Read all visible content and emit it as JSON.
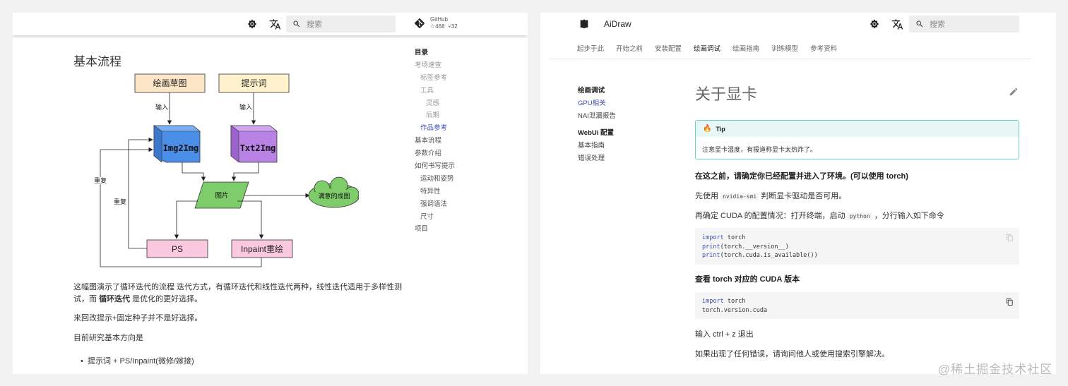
{
  "left": {
    "search_placeholder": "搜索",
    "github": {
      "label": "GitHub",
      "stars": "468",
      "forks": "32"
    },
    "title": "基本流程",
    "diagram": {
      "sketch": "绘画草图",
      "prompt": "提示词",
      "input1": "输入",
      "input2": "输入",
      "img2img": "Img2Img",
      "txt2img": "Txt2Img",
      "picture": "图片",
      "result": "满意的成图",
      "repeat1": "重复",
      "repeat2": "重复",
      "ps": "PS",
      "inpaint": "Inpaint重绘"
    },
    "para1_a": "这幅图演示了循环迭代的流程 迭代方式，有循环迭代和线性迭代两种，线性迭代适用于多样性测",
    "para1_b1": "试，而 ",
    "para1_b_bold": "循环迭代",
    "para1_b2": " 是优化的更好选择。",
    "para2": "来回改提示+固定种子并不是好选择。",
    "para3": "目前研究基本方向是",
    "bullet1": "提示词 + PS/Inpaint(微修/嫁接)",
    "toc": {
      "heading": "目录",
      "items": [
        "考场速查",
        "标签参考",
        "工具",
        "灵感",
        "后期",
        "作品参考",
        "基本流程",
        "参数介绍",
        "如何书写提示",
        "运动和姿势",
        "特异性",
        "强调语法",
        "尺寸",
        "项目"
      ]
    }
  },
  "right": {
    "site_title": "AiDraw",
    "search_placeholder": "搜索",
    "tabs": [
      "起步于此",
      "开始之前",
      "安装配置",
      "绘画调试",
      "绘画指南",
      "训练模型",
      "参考资料"
    ],
    "nav": [
      "绘画调试",
      "GPU相关",
      "NAI泄漏报告",
      "WebUi 配置",
      "基本指南",
      "错误处理"
    ],
    "title": "关于显卡",
    "tip_label": "Tip",
    "tip_text": "注意显卡温度，有报道称显卡太热炸了。",
    "p1": "在这之前，请确定你已经配置并进入了环境。(可以使用 torch)",
    "p2_a": "先使用 ",
    "p2_code": "nvidia-smi",
    "p2_b": " 判断显卡驱动是否可用。",
    "p3_a": "再确定 CUDA 的配置情况：打开终端，启动 ",
    "p3_code": "python",
    "p3_b": " ，分行输入如下命令",
    "code1": {
      "l1_kw": "import",
      "l1_rest": " torch",
      "l2_kw": "print",
      "l2_rest": "(torch.__version__)",
      "l3_kw": "print",
      "l3_rest": "(torch.cuda.is_available())"
    },
    "h2": "查看 torch 对应的 CUDA 版本",
    "code2": {
      "l1_kw": "import",
      "l1_rest": " torch",
      "l2": "torch.version.cuda"
    },
    "p4": "输入 ctrl + z 退出",
    "p5": "如果出现了任何错误，请询问他人或使用搜索引擎解决。"
  },
  "watermark": "@稀土掘金技术社区",
  "colors": {
    "accent": "#3f51b5",
    "tip_border": "#6ad3c9"
  }
}
